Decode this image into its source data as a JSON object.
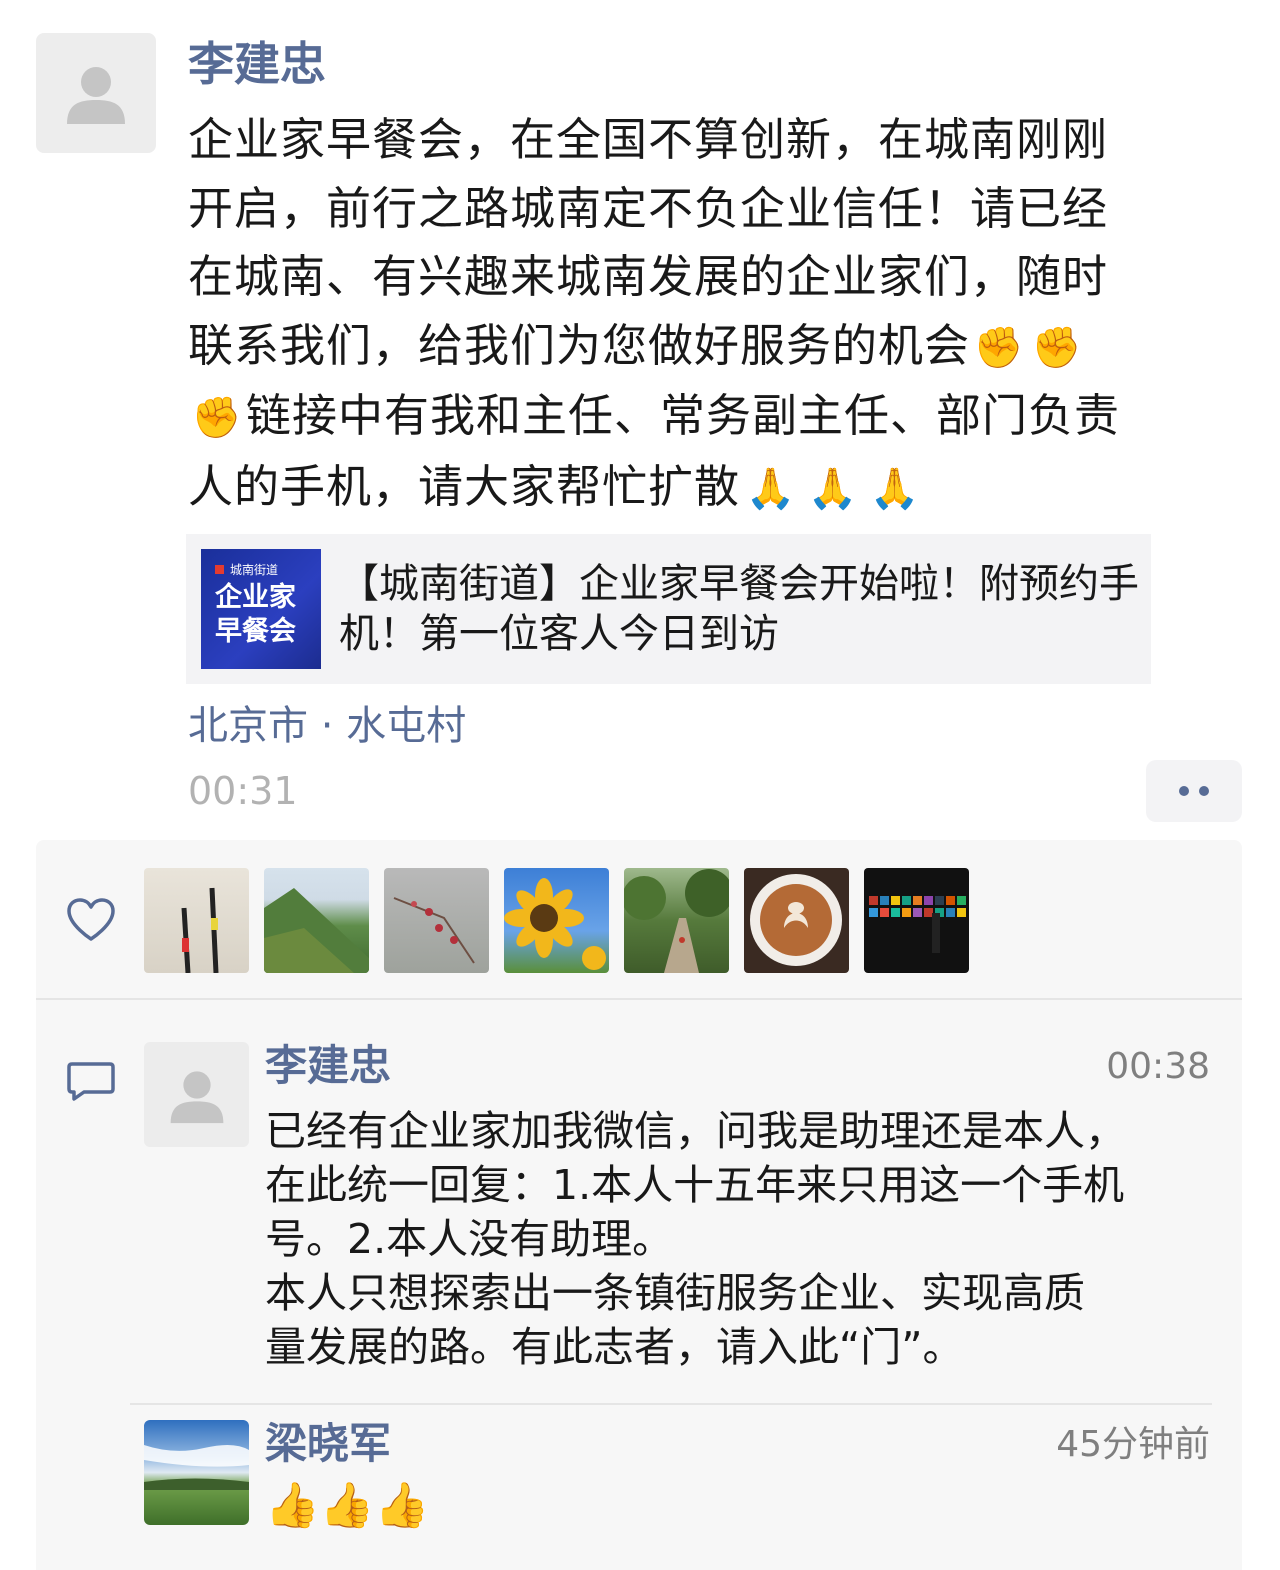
{
  "post": {
    "author": "李建忠",
    "text_lines": [
      "企业家早餐会，在全国不算创新，在城南刚刚",
      "开启，前行之路城南定不负企业信任！请已经",
      "在城南、有兴趣来城南发展的企业家们，随时",
      "联系我们，给我们为您做好服务的机会",
      "链接中有我和主任、常务副主任、部门负责",
      "人的手机，请大家帮忙扩散"
    ],
    "emoji_fist": "✊",
    "emoji_pray": "🙏",
    "link": {
      "thumb_top": "城南街道",
      "thumb_main_line1": "企业家",
      "thumb_main_line2": "早餐会",
      "title": "【城南街道】企业家早餐会开始啦！附预约手机！第一位客人今日到访"
    },
    "location": "北京市 · 水屯村",
    "time": "00:31"
  },
  "likes": {
    "icon": "heart-outline-icon",
    "avatars": [
      "skis",
      "mountain-ridge",
      "plum-blossom",
      "sunflower",
      "garden-path",
      "latte-art",
      "dark-gallery"
    ]
  },
  "comments": [
    {
      "name": "李建忠",
      "time": "00:38",
      "text": "已经有企业家加我微信，问我是助理还是本人，\n在此统一回复：1.本人十五年来只用这一个手机\n号。2.本人没有助理。\n本人只想探索出一条镇街服务企业、实现高质\n量发展的路。有此志者，请入此“门”。"
    },
    {
      "name": "梁晓军",
      "time": "45分钟前",
      "text": "👍👍👍"
    }
  ],
  "colors": {
    "name_blue": "#576b95",
    "time_gray": "#b2b2b2",
    "box_bg": "#f7f7f7"
  }
}
